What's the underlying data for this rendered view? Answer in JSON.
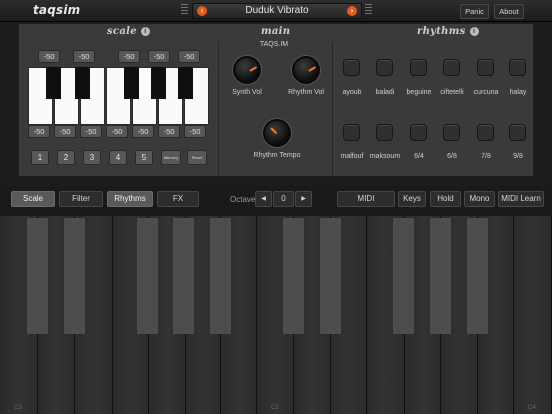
{
  "app": {
    "logo": "taqsim",
    "preset_name": "Duduk Vibrato",
    "prev_icon": "‹",
    "next_icon": "›",
    "panic_label": "Panic",
    "about_label": "About"
  },
  "scale": {
    "title": "scale",
    "info": "i",
    "top_cents": [
      "-50",
      "-50",
      "-50",
      "-50",
      "-50"
    ],
    "bottom_cents": [
      "-50",
      "-50",
      "-50",
      "-50",
      "-50",
      "-50",
      "-50"
    ],
    "memory_buttons": [
      "1",
      "2",
      "3",
      "4",
      "5"
    ],
    "memory_label": "Memory",
    "reset_label": "Reset"
  },
  "main": {
    "title": "main",
    "subtitle": "TAQS.IM",
    "synth_vol_label": "Synth Vol",
    "rhythm_vol_label": "Rhythm Vol",
    "rhythm_tempo_label": "Rhythm Tempo"
  },
  "rhythms": {
    "title": "rhythms",
    "info": "i",
    "row1": [
      "ayoub",
      "baladi",
      "beguine",
      "ciftetelli",
      "curcuna",
      "halay"
    ],
    "row2": [
      "malfouf",
      "maksoum",
      "6/4",
      "6/8",
      "7/8",
      "9/8"
    ]
  },
  "controls": {
    "scale_label": "Scale",
    "filter_label": "Filter",
    "rhythms_label": "Rhythms",
    "fx_label": "FX",
    "octave_label": "Octave",
    "octave_down": "◀",
    "octave_value": "0",
    "octave_up": "▶",
    "midi_label": "MIDI",
    "keys_label": "Keys",
    "hold_label": "Hold",
    "mono_label": "Mono",
    "midi_learn_label": "MIDI Learn",
    "active_tab": "Rhythms"
  },
  "keyboard": {
    "labels": [
      "C3",
      "C3",
      "C4"
    ]
  },
  "colors": {
    "accent": "#e55a1c",
    "knob_indicator": "#ee7a2a",
    "panel": "#3a3a3a"
  }
}
